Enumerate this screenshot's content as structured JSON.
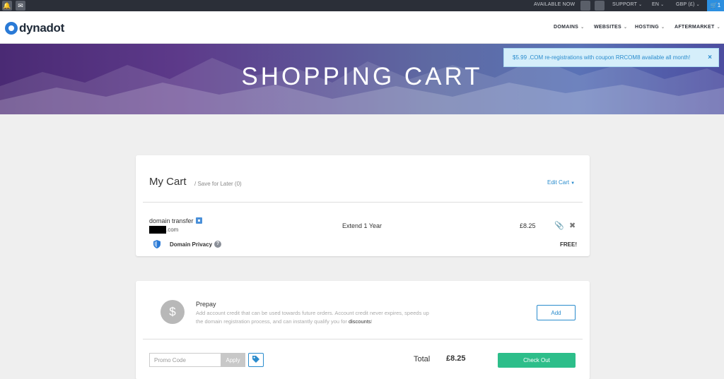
{
  "topbar": {
    "available_now": "AVAILABLE NOW",
    "support": "SUPPORT",
    "language": "EN",
    "currency": "GBP (£)",
    "cart_count": "1",
    "caret": "⌄"
  },
  "header": {
    "logo": "dynadot",
    "nav": [
      "DOMAINS",
      "WEBSITES",
      "HOSTING",
      "AFTERMARKET"
    ]
  },
  "hero": {
    "title": "SHOPPING CART",
    "promo": "$5.99 .COM re-registrations with coupon RRCOM8 available all month!",
    "close": "×"
  },
  "cart": {
    "title": "My Cart",
    "save_later": "/ Save for Later (0)",
    "edit": "Edit Cart",
    "item": {
      "type": "domain transfer",
      "domain_suffix": ".com",
      "term": "Extend 1 Year",
      "price": "£8.25"
    },
    "privacy": {
      "label": "Domain Privacy",
      "price": "FREE!"
    }
  },
  "prepay": {
    "icon": "$",
    "title": "Prepay",
    "desc": "Add account credit that can be used towards future orders. Account credit never expires, speeds up the domain registration process, and can instantly qualify you for",
    "desc_link": "discounts",
    "desc_end": "!",
    "add": "Add"
  },
  "checkout": {
    "promo_placeholder": "Promo Code",
    "apply": "Apply",
    "total_label": "Total",
    "total_value": "£8.25",
    "checkout": "Check Out"
  },
  "colors": {
    "accent": "#2a8ccd",
    "checkout": "#2dbe8a",
    "topbar": "#2b2f38"
  }
}
